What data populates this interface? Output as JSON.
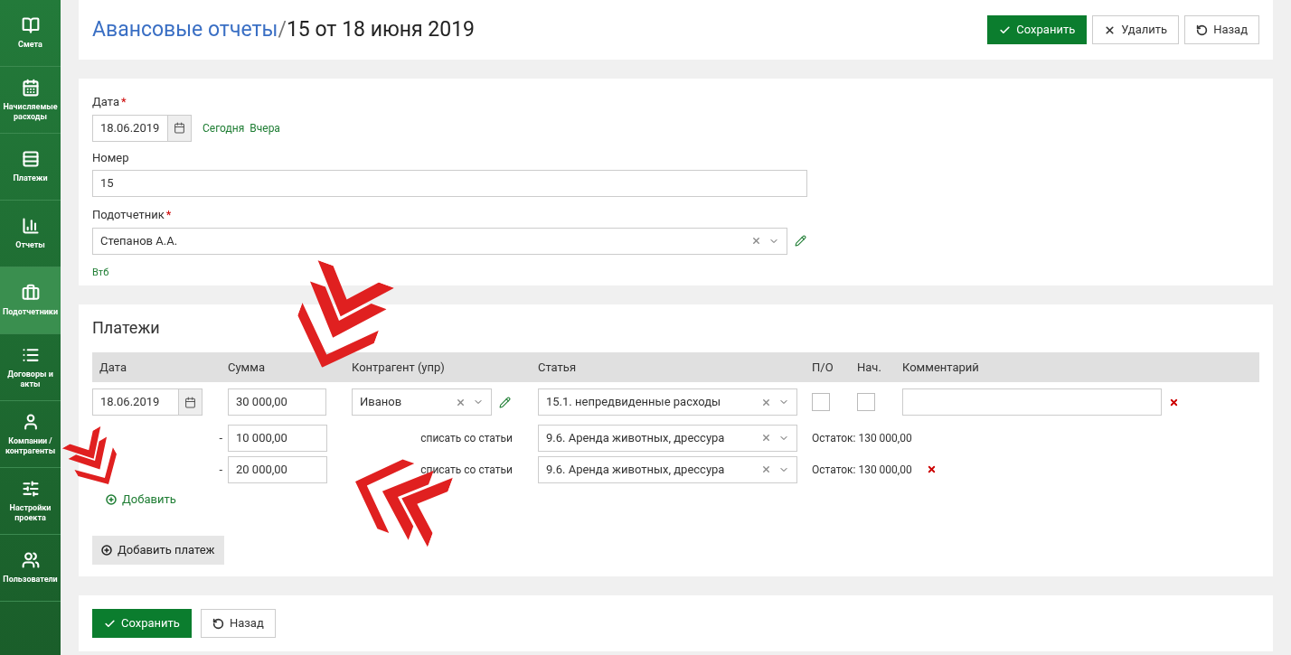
{
  "sidebar": {
    "items": [
      {
        "label": "Смета",
        "selected": false
      },
      {
        "label": "Начисляемые расходы",
        "selected": false
      },
      {
        "label": "Платежи",
        "selected": false
      },
      {
        "label": "Отчеты",
        "selected": false
      },
      {
        "label": "Подотчетники",
        "selected": true
      },
      {
        "label": "Договоры и акты",
        "selected": false
      },
      {
        "label": "Компании / контрагенты",
        "selected": false
      },
      {
        "label": "Настройки проекта",
        "selected": false
      },
      {
        "label": "Пользователи",
        "selected": false
      }
    ]
  },
  "header": {
    "breadcrumb_link": "Авансовые отчеты",
    "separator": "/",
    "title": "15 от 18 июня 2019",
    "buttons": [
      {
        "kind": "save",
        "label": "Сохранить"
      },
      {
        "kind": "delete",
        "label": "Удалить"
      },
      {
        "kind": "back",
        "label": "Назад"
      }
    ]
  },
  "form": {
    "date": {
      "label": "Дата",
      "required_mark": "*",
      "value": "18.06.2019",
      "quick_links": [
        "Сегодня",
        "Вчера"
      ]
    },
    "number": {
      "label": "Номер",
      "value": "15"
    },
    "accountable": {
      "label": "Подотчетник",
      "required_mark": "*",
      "value": "Степанов А.А."
    },
    "note": "Втб"
  },
  "payments": {
    "title": "Платежи",
    "columns": [
      "Дата",
      "Сумма",
      "Контрагент (упр)",
      "Статья",
      "П/О",
      "Нач.",
      "Комментарий"
    ],
    "rows": [
      {
        "date": "18.06.2019",
        "amount": "30 000,00",
        "counterparty": "Иванов",
        "article": "15.1. непредвиденные расходы",
        "po": false,
        "nach": false,
        "comment": "",
        "writeoffs": [
          {
            "dash": "-",
            "amount": "10 000,00",
            "label": "списать со статьи",
            "article": "9.6. Аренда животных, дрессура",
            "remainder": "Остаток: 130 000,00",
            "removable": false
          },
          {
            "dash": "-",
            "amount": "20 000,00",
            "label": "списать со статьи",
            "article": "9.6. Аренда животных, дрессура",
            "remainder": "Остаток: 130 000,00",
            "removable": true
          }
        ],
        "add_label": "Добавить"
      }
    ],
    "add_payment": "Добавить платеж"
  },
  "footer": {
    "buttons": [
      {
        "kind": "save",
        "label": "Сохранить"
      },
      {
        "kind": "back",
        "label": "Назад"
      }
    ]
  }
}
